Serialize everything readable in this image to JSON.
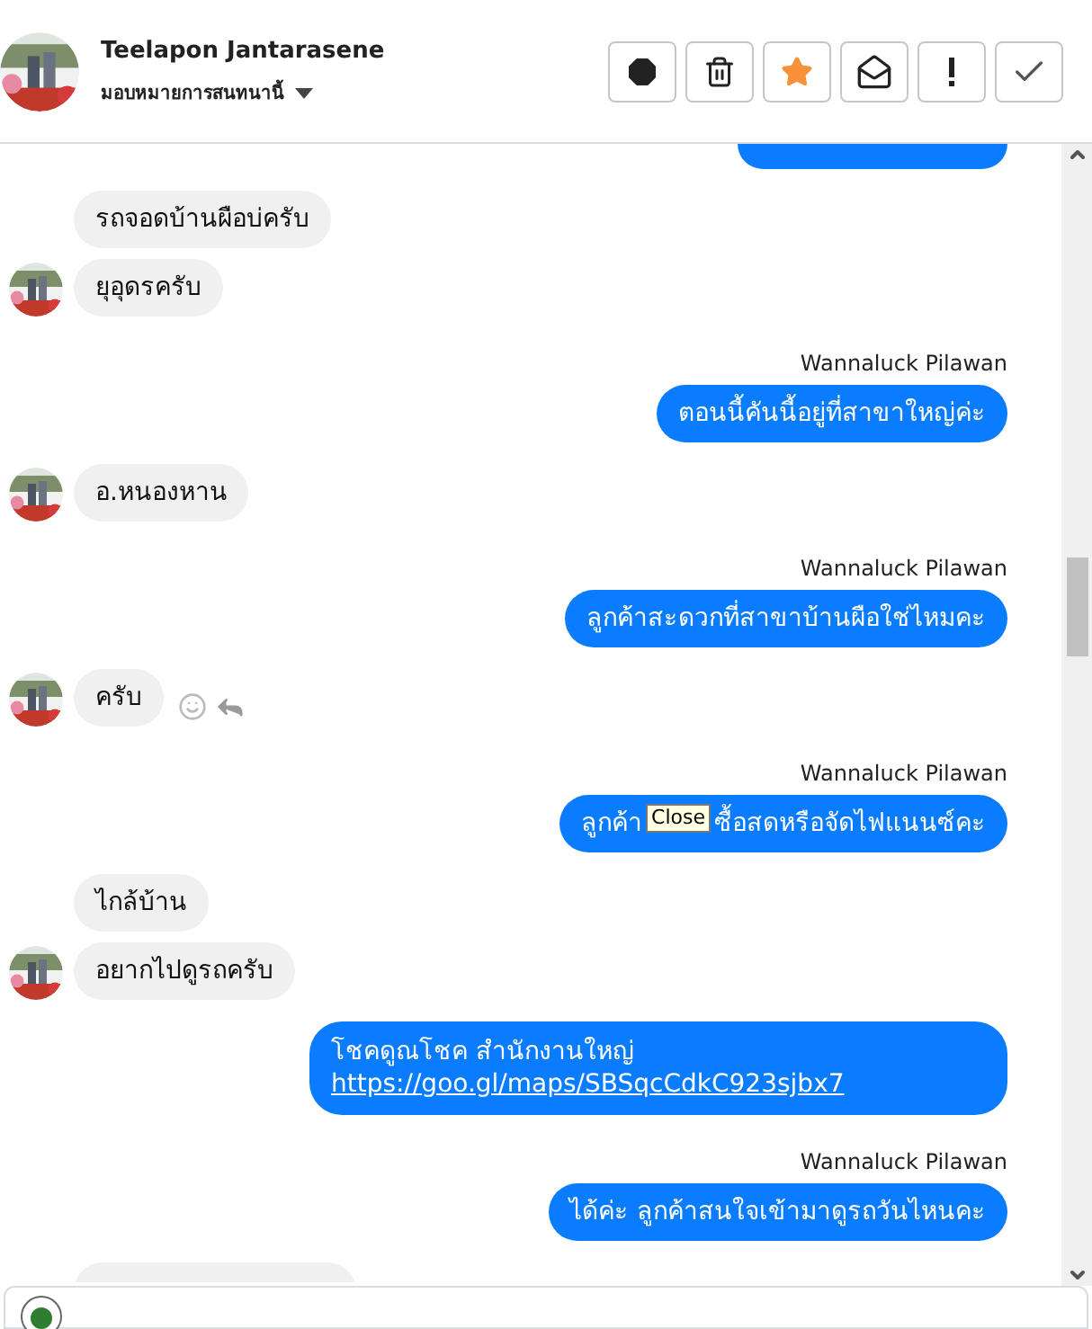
{
  "header": {
    "name": "Teelapon Jantarasene",
    "assign_label": "มอบหมายการสนทนานี้",
    "actions": [
      {
        "kind": "alert"
      },
      {
        "kind": "delete"
      },
      {
        "kind": "star"
      },
      {
        "kind": "mail"
      },
      {
        "kind": "important"
      },
      {
        "kind": "done"
      }
    ]
  },
  "messages": [
    {
      "kind": "outgoing_partial"
    },
    {
      "kind": "incoming",
      "bubbles": [
        {
          "text": "รถจอดบ้านผือบ่ครับ"
        },
        {
          "text": "ยุอุดรครับ"
        }
      ]
    },
    {
      "kind": "sender",
      "text": "Wannaluck Pilawan"
    },
    {
      "kind": "outgoing",
      "text": "ตอนนี้คันนี้อยู่ที่สาขาใหญ่ค่ะ"
    },
    {
      "kind": "incoming",
      "bubbles": [
        {
          "text": "อ.หนองหาน"
        }
      ]
    },
    {
      "kind": "sender",
      "text": "Wannaluck Pilawan"
    },
    {
      "kind": "outgoing",
      "text": "ลูกค้าสะดวกที่สาขาบ้านผือใช่ไหมคะ"
    },
    {
      "kind": "incoming",
      "bubbles": [
        {
          "text": "ครับ",
          "reactions": true
        }
      ]
    },
    {
      "kind": "sender",
      "text": "Wannaluck Pilawan"
    },
    {
      "kind": "outgoing_tooltip",
      "text": "ลูกค้า",
      "tooltip": "Close",
      "text_after": "ซื้อสดหรือจัดไฟแนนซ์คะ"
    },
    {
      "kind": "incoming",
      "bubbles": [
        {
          "text": "ไกล้บ้าน"
        },
        {
          "text": "อยากไปดูรถครับ"
        }
      ]
    },
    {
      "kind": "outgoing_link",
      "text": "โชคดูณโชค สำนักงานใหญ่",
      "link": "https://goo.gl/maps/SBSqcCdkC923sjbx7"
    },
    {
      "kind": "sender",
      "text": "Wannaluck Pilawan"
    },
    {
      "kind": "outgoing",
      "text": "ได้ค่ะ ลูกค้าสนใจเข้ามาดูรถวันไหนคะ"
    },
    {
      "kind": "incoming_partial"
    }
  ]
}
